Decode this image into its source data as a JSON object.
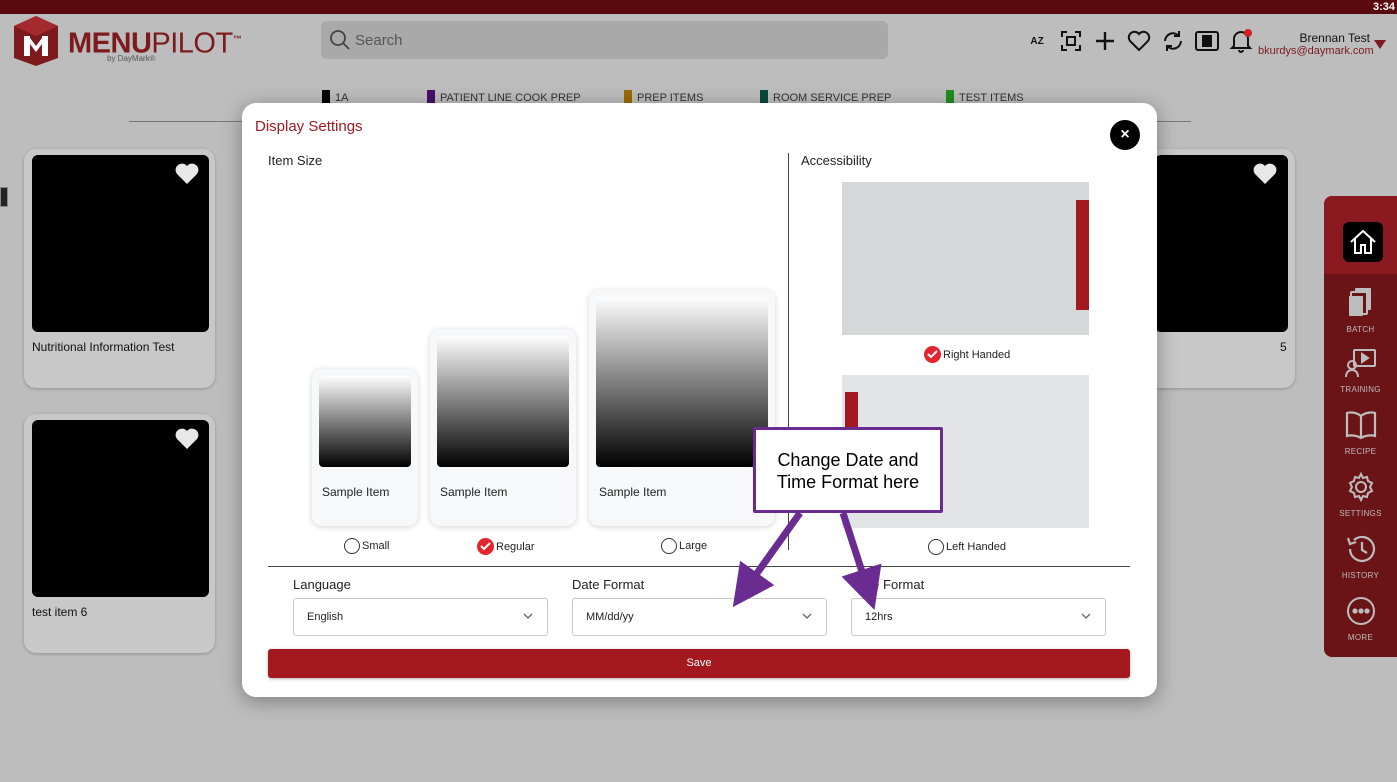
{
  "status_bar": {
    "time": "3:34"
  },
  "header": {
    "logo": {
      "brand_a": "MENU",
      "brand_b": "PILOT",
      "tm": "™",
      "byline": "by DayMark®"
    },
    "search": {
      "placeholder": "Search"
    },
    "icons": [
      "sort-az-icon",
      "scan-icon",
      "plus-icon",
      "heart-icon",
      "refresh-icon",
      "display-icon",
      "bell-icon"
    ],
    "az_label_top": "A",
    "az_label_bottom": "Z",
    "user": {
      "name": "Brennan Test",
      "email": "bkurdys@daymark.com"
    }
  },
  "categories": [
    {
      "label": "1A",
      "color": "#000000"
    },
    {
      "label": "PATIENT LINE COOK PREP",
      "color": "#4b0f6b"
    },
    {
      "label": "PREP ITEMS",
      "color": "#9c6a00"
    },
    {
      "label": "ROOM SERVICE PREP",
      "color": "#0a4a3a"
    },
    {
      "label": "TEST ITEMS",
      "color": "#1e8f1e"
    }
  ],
  "cards": [
    {
      "label": "Nutritional Information Test"
    },
    {
      "label": "test item 6"
    },
    {
      "label": "5"
    }
  ],
  "sidenav": {
    "items": [
      {
        "label": "BATCH",
        "icon": "batch-icon"
      },
      {
        "label": "TRAINING",
        "icon": "training-icon"
      },
      {
        "label": "RECIPE",
        "icon": "recipe-icon"
      },
      {
        "label": "SETTINGS",
        "icon": "settings-icon"
      },
      {
        "label": "HISTORY",
        "icon": "history-icon"
      },
      {
        "label": "MORE",
        "icon": "more-icon"
      }
    ]
  },
  "modal": {
    "title": "Display Settings",
    "close": "×",
    "item_size": {
      "label": "Item Size",
      "samples": [
        {
          "text": "Sample Item",
          "option": "Small",
          "selected": false
        },
        {
          "text": "Sample Item",
          "option": "Regular",
          "selected": true
        },
        {
          "text": "Sample Item",
          "option": "Large",
          "selected": false
        }
      ]
    },
    "accessibility": {
      "label": "Accessibility",
      "options": [
        {
          "option": "Right Handed",
          "selected": true
        },
        {
          "option": "Left Handed",
          "selected": false
        }
      ]
    },
    "fields": {
      "language": {
        "label": "Language",
        "value": "English"
      },
      "date_format": {
        "label": "Date Format",
        "value": "MM/dd/yy"
      },
      "time_format": {
        "label": "Time Format",
        "value": "12hrs"
      }
    },
    "save_label": "Save"
  },
  "callout": {
    "line1": "Change Date and",
    "line2": "Time Format here",
    "border_color": "#6a2c91"
  },
  "colors": {
    "brand_red": "#a3191f",
    "check_red": "#e3262d",
    "annotation_purple": "#6a2c91"
  }
}
